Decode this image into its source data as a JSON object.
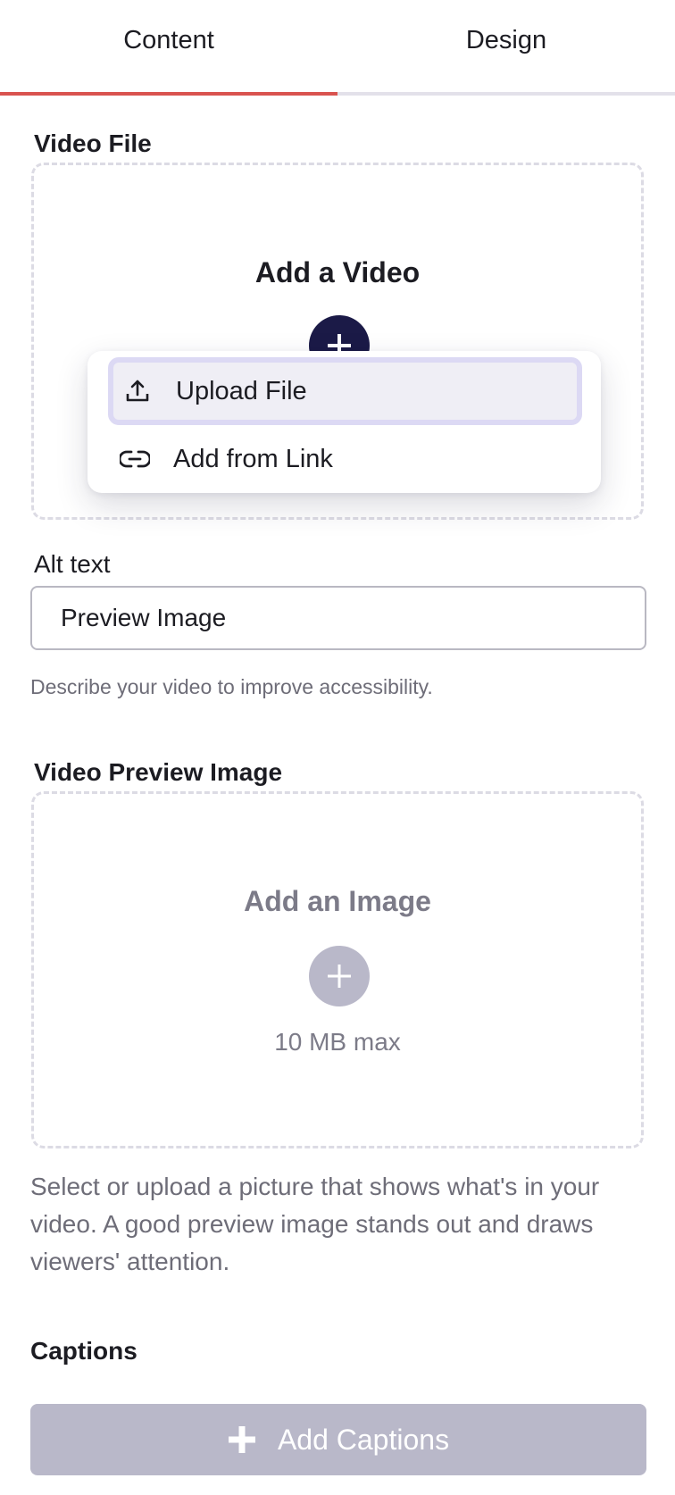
{
  "tabs": [
    {
      "label": "Content",
      "active": true
    },
    {
      "label": "Design",
      "active": false
    }
  ],
  "colors": {
    "tab_active_indicator": "#d9534f",
    "primary_dark": "#1b1a47",
    "disabled_gray": "#b9b8c9",
    "menu_highlight": "#efeef5"
  },
  "video_file": {
    "section_title": "Video File",
    "dropzone_title": "Add a Video",
    "add_icon": "plus-icon"
  },
  "upload_menu": {
    "items": [
      {
        "label": "Upload File",
        "icon": "upload-icon",
        "highlighted": true
      },
      {
        "label": "Add from Link",
        "icon": "link-icon",
        "highlighted": false
      }
    ]
  },
  "alt_text": {
    "label": "Alt text",
    "value": "Preview Image",
    "helper": "Describe your video to improve accessibility."
  },
  "preview_image": {
    "section_title": "Video Preview Image",
    "dropzone_title": "Add an Image",
    "max_size": "10 MB max",
    "helper": "Select or upload a picture that shows what's in your video. A good preview image stands out and draws viewers' attention."
  },
  "captions": {
    "section_title": "Captions",
    "button_label": "Add Captions"
  }
}
